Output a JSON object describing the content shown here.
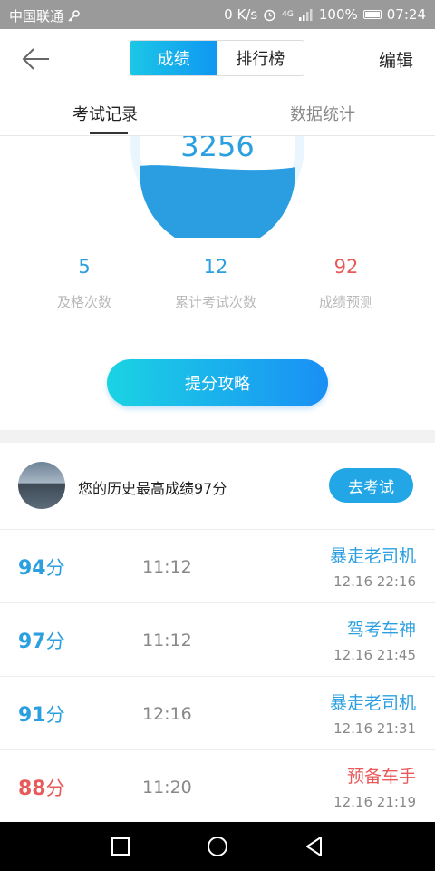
{
  "status_bar": {
    "carrier": "中国联通",
    "speed": "0 K/s",
    "network": "4G",
    "battery": "100%",
    "time": "07:24"
  },
  "header": {
    "tab_scores": "成绩",
    "tab_rank": "排行榜",
    "edit": "编辑"
  },
  "tabs": {
    "records": "考试记录",
    "stats": "数据统计"
  },
  "gauge": {
    "value": "3256"
  },
  "stats": [
    {
      "value": "5",
      "label": "及格次数",
      "color": "#2c9fe0"
    },
    {
      "value": "12",
      "label": "累计考试次数",
      "color": "#2c9fe0"
    },
    {
      "value": "92",
      "label": "成绩预测",
      "color": "#e85a5a"
    }
  ],
  "cta": {
    "label": "提分攻略"
  },
  "best": {
    "text": "您的历史最高成绩97分",
    "button": "去考试"
  },
  "records": [
    {
      "score": "94",
      "unit": "分",
      "duration": "11:12",
      "title": "暴走老司机",
      "date": "12.16  22:16",
      "color": "#2c9fe0"
    },
    {
      "score": "97",
      "unit": "分",
      "duration": "11:12",
      "title": "驾考车神",
      "date": "12.16  21:45",
      "color": "#2c9fe0"
    },
    {
      "score": "91",
      "unit": "分",
      "duration": "12:16",
      "title": "暴走老司机",
      "date": "12.16  21:31",
      "color": "#2c9fe0"
    },
    {
      "score": "88",
      "unit": "分",
      "duration": "11:20",
      "title": "预备车手",
      "date": "12.16  21:19",
      "color": "#e85a5a"
    }
  ],
  "colors": {
    "accent": "#1a9cf0",
    "pass": "#2c9fe0",
    "fail": "#e85a5a"
  },
  "icons": [
    "back-arrow-icon",
    "key-icon",
    "alarm-icon",
    "signal-icon",
    "battery-icon",
    "square-nav-icon",
    "circle-nav-icon",
    "triangle-nav-icon"
  ]
}
